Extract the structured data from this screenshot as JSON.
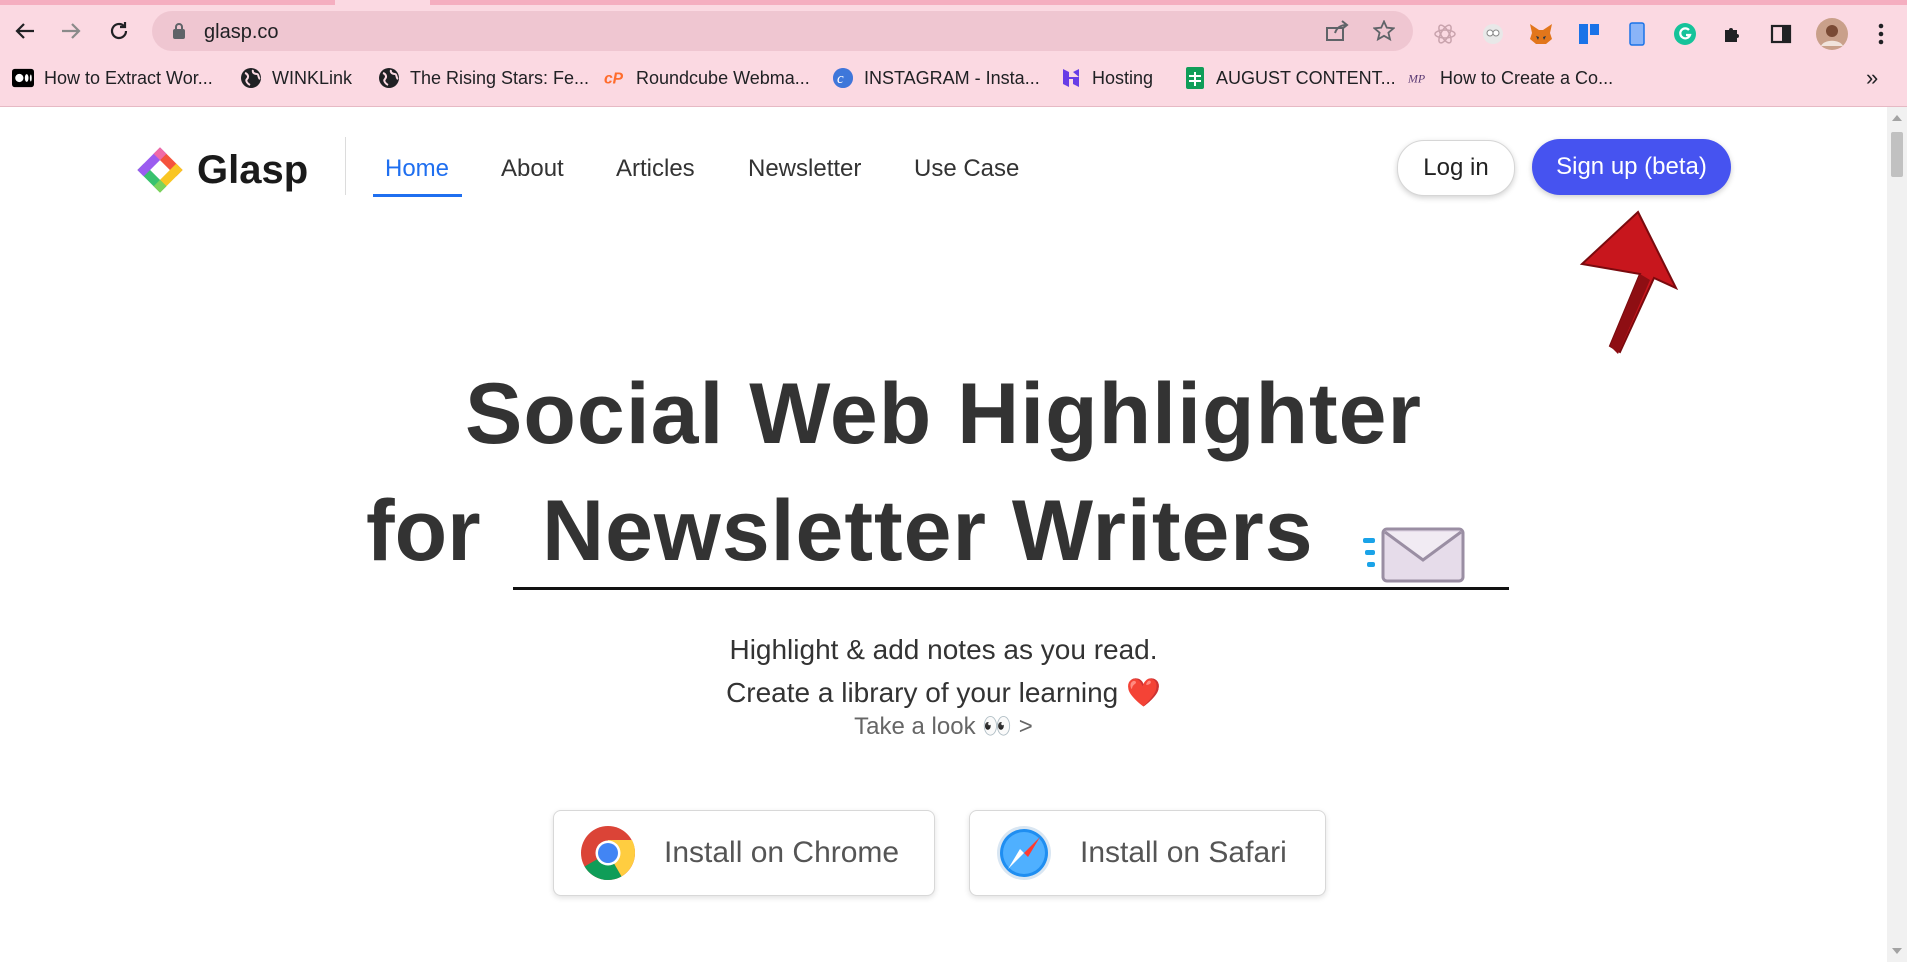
{
  "browser": {
    "url": "glasp.co",
    "bookmarks": [
      {
        "label": "How to Extract Wor...",
        "icon": "medium-icon"
      },
      {
        "label": "WINKLink",
        "icon": "globe-icon"
      },
      {
        "label": "The Rising Stars: Fe...",
        "icon": "globe-icon"
      },
      {
        "label": "Roundcube Webma...",
        "icon": "cpanel-icon"
      },
      {
        "label": "INSTAGRAM - Insta...",
        "icon": "canva-icon"
      },
      {
        "label": "Hosting",
        "icon": "hostinger-icon"
      },
      {
        "label": "AUGUST CONTENT...",
        "icon": "sheets-icon"
      },
      {
        "label": "How to Create a Co...",
        "icon": "mp-icon"
      }
    ],
    "more_bookmarks": "»"
  },
  "header": {
    "brand": "Glasp",
    "nav": [
      "Home",
      "About",
      "Articles",
      "Newsletter",
      "Use Case"
    ],
    "active_nav": "Home",
    "login_label": "Log in",
    "signup_label": "Sign up (beta)"
  },
  "hero": {
    "line1": "Social Web Highlighter",
    "line2_prefix": "for",
    "line2_typed": "Newsletter Writers",
    "subtitle1": "Highlight & add notes as you read.",
    "subtitle2": "Create a library of your learning",
    "heart": "❤️",
    "take_a_look": "Take a look 👀 >"
  },
  "install": {
    "chrome_label": "Install on Chrome",
    "safari_label": "Install on Safari"
  },
  "colors": {
    "chrome_bg": "#fbd9e2",
    "omnibox_bg": "#efc6d1",
    "accent_blue": "#1f6ff0",
    "signup_bg": "#4653f0",
    "annotation_arrow": "#c8161d"
  }
}
